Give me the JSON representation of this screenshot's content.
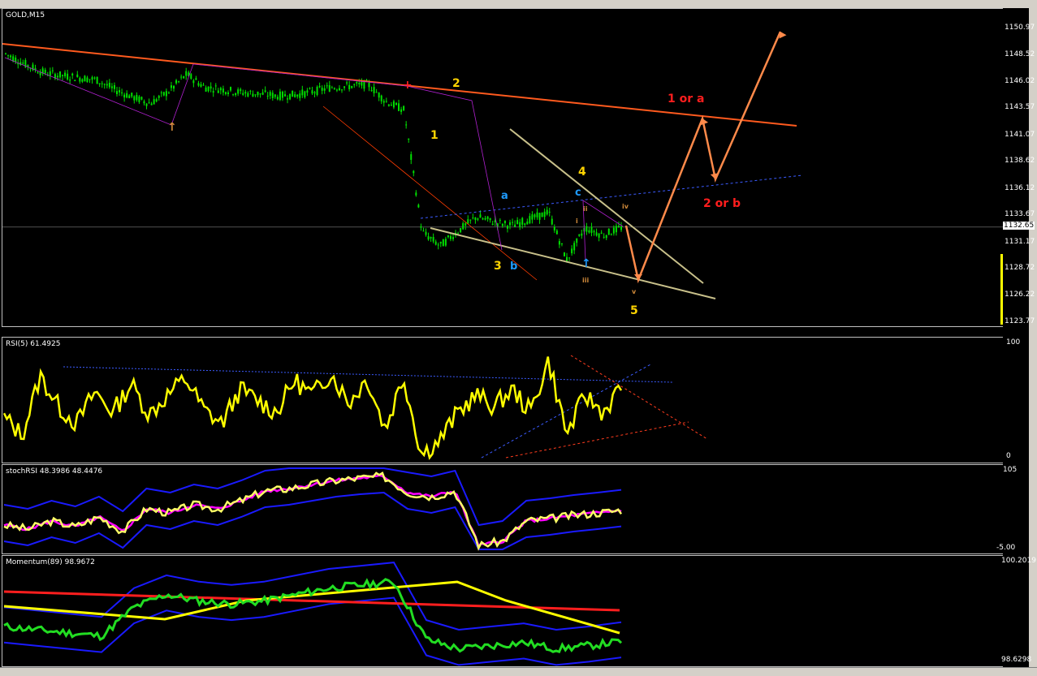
{
  "symbol_label": "GOLD,M15",
  "price_chart": {
    "ticks": [
      "1150.97",
      "1148.52",
      "1146.02",
      "1143.57",
      "1141.07",
      "1138.62",
      "1136.12",
      "1133.67",
      "1131.17",
      "1128.72",
      "1126.22",
      "1123.77"
    ],
    "current_price": "1132.65",
    "wave_labels": [
      {
        "text": "1",
        "color": "#ffd400"
      },
      {
        "text": "2",
        "color": "#ffd400"
      },
      {
        "text": "3",
        "color": "#ffd400"
      },
      {
        "text": "4",
        "color": "#ffd400"
      },
      {
        "text": "5",
        "color": "#ffd400"
      },
      {
        "text": "a",
        "color": "#1e9bff"
      },
      {
        "text": "b",
        "color": "#1e9bff"
      },
      {
        "text": "c",
        "color": "#1e9bff"
      },
      {
        "text": "ii",
        "color": "#d08a3a"
      },
      {
        "text": "iii",
        "color": "#d08a3a"
      },
      {
        "text": "iv",
        "color": "#d08a3a"
      },
      {
        "text": "v",
        "color": "#d08a3a"
      },
      {
        "text": "i",
        "color": "#d08a3a"
      },
      {
        "text": "1 or a",
        "color": "#ff1e1e"
      },
      {
        "text": "2 or b",
        "color": "#ff1e1e"
      }
    ]
  },
  "rsi_panel": {
    "title": "RSI(5) 61.4925",
    "ticks": [
      "100",
      "0"
    ]
  },
  "stochrsi_panel": {
    "title": "stochRSI 48.3986 48.4476",
    "ticks": [
      "105",
      "-5.00"
    ]
  },
  "momentum_panel": {
    "title": "Momentum(89) 98.9672",
    "ticks": [
      "100.2019",
      "98.6298"
    ]
  },
  "colors": {
    "candles": "#00e000",
    "resistance": "#ff5a1e",
    "projection": "#ff8a4a",
    "wedge": "#c8c08a",
    "rsi": "#ffff00",
    "stoch_fast": "#ffff66",
    "stoch_slow": "#ff00ff",
    "momentum": "#22dd22",
    "ma_red": "#ff1e1e",
    "ma_yellow": "#ffff00",
    "band": "#1a1aff"
  },
  "chart_data": {
    "type": "line",
    "title": "GOLD,M15",
    "ylim": [
      1123.77,
      1150.97
    ],
    "x_description": "bars (unlabeled time axis)",
    "series": [
      {
        "name": "GOLD,M15",
        "values": [
          1148.7,
          1147.8,
          1147.0,
          1146.7,
          1146.5,
          1146.3,
          1145.4,
          1144.7,
          1144.1,
          1145.2,
          1146.8,
          1145.6,
          1145.4,
          1145.1,
          1145.0,
          1144.8,
          1144.9,
          1145.2,
          1145.6,
          1145.7,
          1145.9,
          1144.3,
          1143.5,
          1132.2,
          1130.9,
          1132.3,
          1133.6,
          1133.1,
          1132.8,
          1133.4,
          1134.0,
          1129.6,
          1132.6,
          1131.9,
          1132.6
        ]
      },
      {
        "name": "RSI(5) 61.4925",
        "values": [
          35,
          20,
          72,
          45,
          30,
          58,
          40,
          65,
          38,
          55,
          70,
          42,
          30,
          60,
          50,
          40,
          68,
          55,
          75,
          48,
          70,
          25,
          72,
          3,
          15,
          40,
          55,
          45,
          60,
          40,
          86,
          20,
          55,
          40,
          61.49
        ]
      },
      {
        "name": "stochRSI 48.3986 48.4476",
        "values": [
          30,
          25,
          35,
          28,
          40,
          22,
          50,
          45,
          55,
          50,
          60,
          72,
          75,
          80,
          85,
          88,
          90,
          70,
          65,
          72,
          5,
          10,
          35,
          38,
          42,
          45,
          48.4
        ]
      },
      {
        "name": "Momentum(89) 98.9672",
        "values": [
          99.2,
          99.15,
          99.1,
          99.05,
          99.5,
          99.7,
          99.6,
          99.55,
          99.6,
          99.7,
          99.8,
          99.85,
          99.9,
          99.0,
          98.85,
          98.9,
          98.95,
          98.85,
          98.9,
          98.9672
        ]
      }
    ]
  }
}
